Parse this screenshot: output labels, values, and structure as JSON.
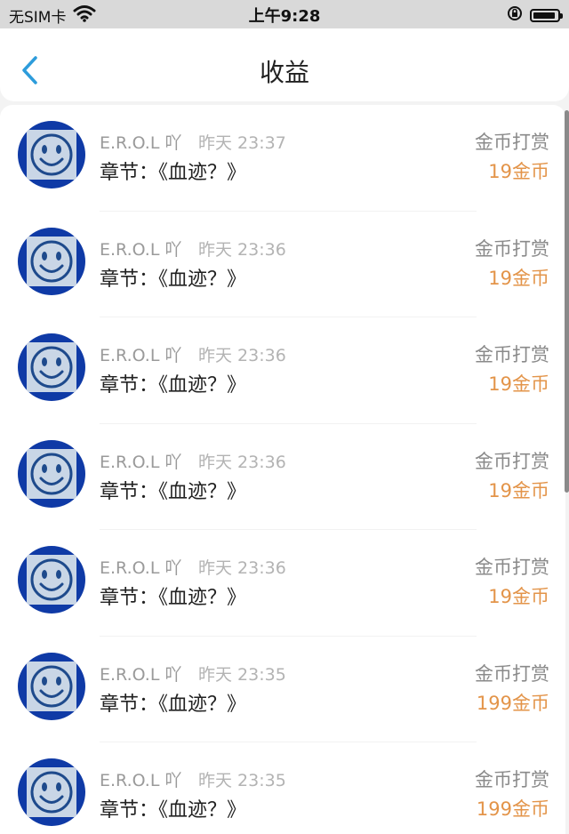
{
  "status_bar": {
    "carrier": "无SIM卡",
    "time": "上午9:28"
  },
  "nav": {
    "title": "收益",
    "back_icon": "chevron-left-icon"
  },
  "colors": {
    "accent": "#2d9cdb",
    "amount": "#e39449",
    "avatar_bg": "#0f3aa6"
  },
  "records": [
    {
      "user": "E.R.O.L 吖",
      "time": "昨天 23:37",
      "chapter": "章节：《血迹？》",
      "type": "金币打赏",
      "amount": "19金币"
    },
    {
      "user": "E.R.O.L 吖",
      "time": "昨天 23:36",
      "chapter": "章节：《血迹？》",
      "type": "金币打赏",
      "amount": "19金币"
    },
    {
      "user": "E.R.O.L 吖",
      "time": "昨天 23:36",
      "chapter": "章节：《血迹？》",
      "type": "金币打赏",
      "amount": "19金币"
    },
    {
      "user": "E.R.O.L 吖",
      "time": "昨天 23:36",
      "chapter": "章节：《血迹？》",
      "type": "金币打赏",
      "amount": "19金币"
    },
    {
      "user": "E.R.O.L 吖",
      "time": "昨天 23:36",
      "chapter": "章节：《血迹？》",
      "type": "金币打赏",
      "amount": "19金币"
    },
    {
      "user": "E.R.O.L 吖",
      "time": "昨天 23:35",
      "chapter": "章节：《血迹？》",
      "type": "金币打赏",
      "amount": "199金币"
    },
    {
      "user": "E.R.O.L 吖",
      "time": "昨天 23:35",
      "chapter": "章节：《血迹？》",
      "type": "金币打赏",
      "amount": "199金币"
    }
  ]
}
